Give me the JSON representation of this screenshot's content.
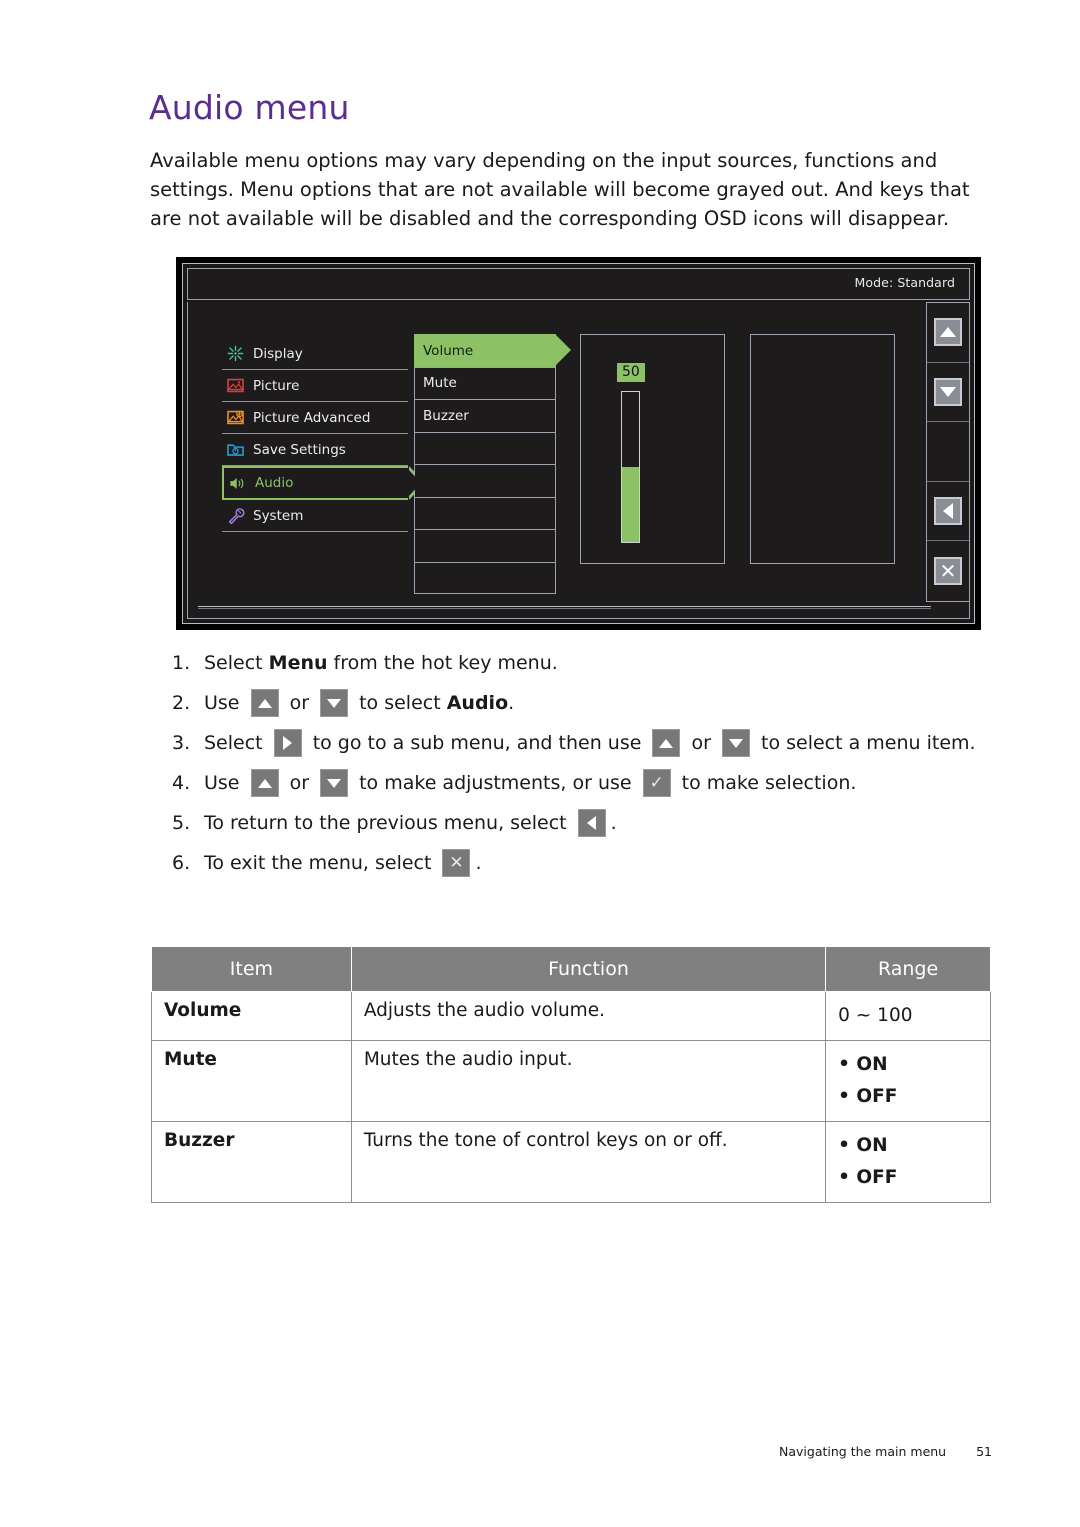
{
  "page": {
    "title": "Audio menu",
    "intro": "Available menu options may vary depending on the input sources, functions and settings. Menu options that are not available will become grayed out. And keys that are not available will be disabled and the corresponding OSD icons will disappear.",
    "accent_color": "#5b2d8e"
  },
  "osd": {
    "mode_label": "Mode: Standard",
    "highlight_color": "#8cc265",
    "background_color": "#1d1b1c",
    "nav": [
      {
        "label": "Display",
        "icon": "brightness-icon",
        "color": "#3fbf9f",
        "selected": false
      },
      {
        "label": "Picture",
        "icon": "picture-icon",
        "color": "#e03b3b",
        "selected": false
      },
      {
        "label": "Picture Advanced",
        "icon": "picture-advanced-icon",
        "color": "#ef8f1c",
        "selected": false
      },
      {
        "label": "Save Settings",
        "icon": "save-settings-icon",
        "color": "#1f9fd8",
        "selected": false
      },
      {
        "label": "Audio",
        "icon": "speaker-icon",
        "color": "#8cc265",
        "selected": true
      },
      {
        "label": "System",
        "icon": "wrench-icon",
        "color": "#a87fe0",
        "selected": false
      }
    ],
    "submenu": [
      {
        "label": "Volume",
        "selected": true
      },
      {
        "label": "Mute",
        "selected": false
      },
      {
        "label": "Buzzer",
        "selected": false
      },
      {
        "label": "",
        "selected": false
      },
      {
        "label": "",
        "selected": false
      },
      {
        "label": "",
        "selected": false
      },
      {
        "label": "",
        "selected": false
      },
      {
        "label": "",
        "selected": false
      }
    ],
    "volume": {
      "value": "50",
      "percent": 50,
      "min": 0,
      "max": 100
    },
    "rail_buttons": [
      {
        "icon": "arrow-up-icon",
        "present": true
      },
      {
        "icon": "arrow-down-icon",
        "present": true
      },
      {
        "icon": "empty-slot",
        "present": false
      },
      {
        "icon": "arrow-left-icon",
        "present": true
      },
      {
        "icon": "close-x-icon",
        "present": true
      }
    ]
  },
  "steps": [
    {
      "num": "1.",
      "parts": [
        {
          "type": "text",
          "value": "Select "
        },
        {
          "type": "bold",
          "value": "Menu"
        },
        {
          "type": "text",
          "value": " from the hot key menu."
        }
      ]
    },
    {
      "num": "2.",
      "parts": [
        {
          "type": "text",
          "value": "Use "
        },
        {
          "type": "key",
          "value": "arrow-up-icon"
        },
        {
          "type": "text",
          "value": " or "
        },
        {
          "type": "key",
          "value": "arrow-down-icon"
        },
        {
          "type": "text",
          "value": " to select "
        },
        {
          "type": "bold",
          "value": "Audio"
        },
        {
          "type": "text",
          "value": "."
        }
      ]
    },
    {
      "num": "3.",
      "parts": [
        {
          "type": "text",
          "value": "Select "
        },
        {
          "type": "key",
          "value": "arrow-right-icon"
        },
        {
          "type": "text",
          "value": " to go to a sub menu, and then use "
        },
        {
          "type": "key",
          "value": "arrow-up-icon"
        },
        {
          "type": "text",
          "value": " or "
        },
        {
          "type": "key",
          "value": "arrow-down-icon"
        },
        {
          "type": "text",
          "value": " to select a menu item."
        }
      ]
    },
    {
      "num": "4.",
      "parts": [
        {
          "type": "text",
          "value": "Use "
        },
        {
          "type": "key",
          "value": "arrow-up-icon"
        },
        {
          "type": "text",
          "value": " or "
        },
        {
          "type": "key",
          "value": "arrow-down-icon"
        },
        {
          "type": "text",
          "value": " to make adjustments, or use "
        },
        {
          "type": "key",
          "value": "check-icon"
        },
        {
          "type": "text",
          "value": " to make selection."
        }
      ]
    },
    {
      "num": "5.",
      "parts": [
        {
          "type": "text",
          "value": "To return to the previous menu, select "
        },
        {
          "type": "key",
          "value": "arrow-left-icon"
        },
        {
          "type": "text",
          "value": "."
        }
      ]
    },
    {
      "num": "6.",
      "parts": [
        {
          "type": "text",
          "value": "To exit the menu, select "
        },
        {
          "type": "key",
          "value": "close-x-icon"
        },
        {
          "type": "text",
          "value": "."
        }
      ]
    }
  ],
  "table": {
    "headers": [
      "Item",
      "Function",
      "Range"
    ],
    "header_bg": "#808080",
    "rows": [
      {
        "item": "Volume",
        "function": "Adjusts the audio volume.",
        "range": [
          "0 ~ 100"
        ],
        "range_bulleted": false
      },
      {
        "item": "Mute",
        "function": "Mutes the audio input.",
        "range": [
          "• ON",
          "• OFF"
        ],
        "range_bulleted": true
      },
      {
        "item": "Buzzer",
        "function": "Turns the tone of control keys on or off.",
        "range": [
          "• ON",
          "• OFF"
        ],
        "range_bulleted": true
      }
    ]
  },
  "footer": {
    "section": "Navigating the main menu",
    "page_number": "51"
  }
}
